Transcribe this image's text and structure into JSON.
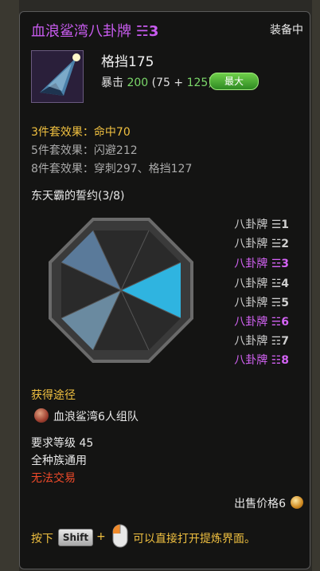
{
  "item": {
    "name": "血浪鲨湾八卦牌",
    "grade_glyph": "☵3",
    "status": "装备中",
    "main_stat": "格挡175",
    "sub_stat_label": "暴击",
    "sub_stat_value": "200",
    "sub_stat_breakdown_a": "(75 +",
    "sub_stat_breakdown_b": "125)",
    "max_badge": "最大"
  },
  "set_effects": {
    "three": "3件套效果：命中70",
    "five": "5件套效果：闪避212",
    "eight": "8件套效果：穿刺297、格挡127"
  },
  "set_name": "东天霸的誓约(3/8)",
  "pieces": [
    {
      "label": "八卦牌",
      "glyph": "☰1",
      "owned": false
    },
    {
      "label": "八卦牌",
      "glyph": "☱2",
      "owned": false
    },
    {
      "label": "八卦牌",
      "glyph": "☲3",
      "owned": true
    },
    {
      "label": "八卦牌",
      "glyph": "☳4",
      "owned": false
    },
    {
      "label": "八卦牌",
      "glyph": "☴5",
      "owned": false
    },
    {
      "label": "八卦牌",
      "glyph": "☵6",
      "owned": true
    },
    {
      "label": "八卦牌",
      "glyph": "☶7",
      "owned": false
    },
    {
      "label": "八卦牌",
      "glyph": "☷8",
      "owned": true
    }
  ],
  "source": {
    "title": "获得途径",
    "text": "血浪鲨湾6人组队"
  },
  "requirements": {
    "level": "要求等级 45",
    "race": "全种族通用",
    "trade": "无法交易"
  },
  "price": "出售价格6",
  "hint": {
    "prefix": "按下",
    "key": "Shift",
    "plus": "+",
    "suffix": "可以直接打开提炼界面。"
  },
  "colors": {
    "title_purple": "#c95cf0",
    "owned_purple": "#d463f5",
    "gold": "#f0c040",
    "green": "#7bd86a",
    "red": "#f04a2a"
  }
}
